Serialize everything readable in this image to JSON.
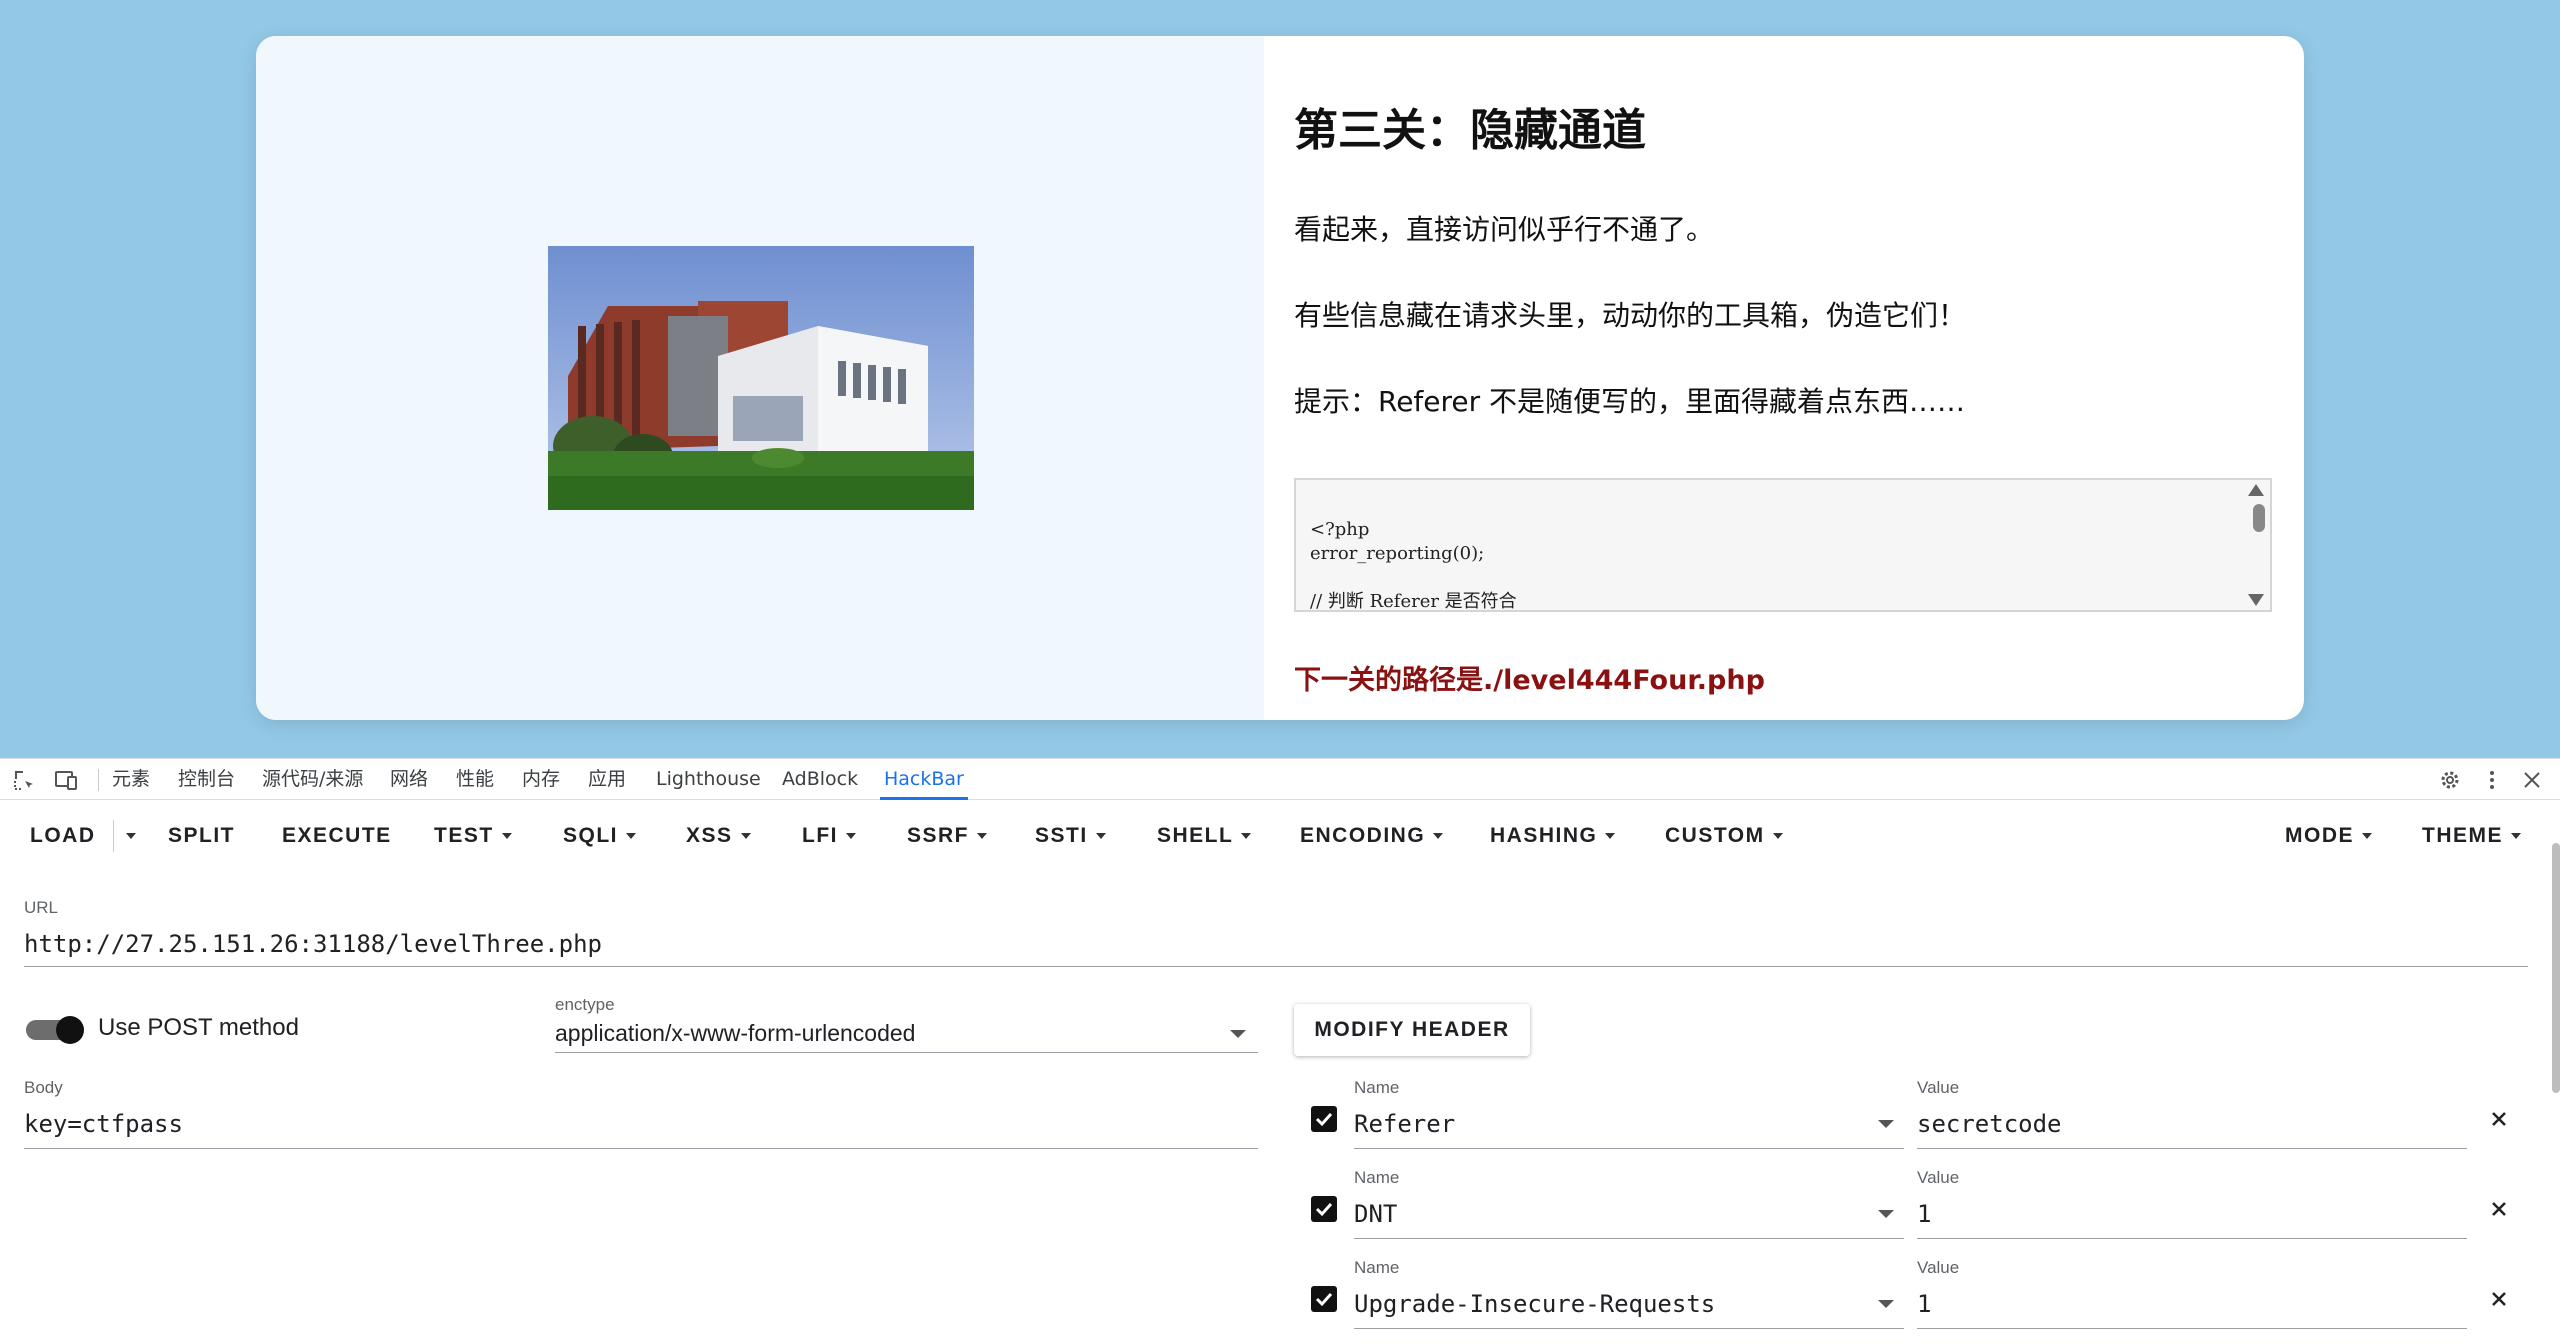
{
  "page": {
    "title": "第三关：隐藏通道",
    "paragraphs": [
      "看起来，直接访问似乎行不通了。",
      "有些信息藏在请求头里，动动你的工具箱，伪造它们！",
      "提示：Referer 不是随便写的，里面得藏着点东西……"
    ],
    "code_lines": "<?php\nerror_reporting(0);\n\n// 判断 Referer 是否符合",
    "next_path": "下一关的路径是./level444Four.php",
    "image_alt": "campus building photo"
  },
  "devtools": {
    "tabs": [
      "元素",
      "控制台",
      "源代码/来源",
      "网络",
      "性能",
      "内存",
      "应用",
      "Lighthouse",
      "AdBlock",
      "HackBar"
    ],
    "active_tab": "HackBar"
  },
  "hackbar": {
    "menu": {
      "load": "LOAD",
      "split": "SPLIT",
      "execute": "EXECUTE",
      "test": "TEST",
      "sqli": "SQLI",
      "xss": "XSS",
      "lfi": "LFI",
      "ssrf": "SSRF",
      "ssti": "SSTI",
      "shell": "SHELL",
      "encoding": "ENCODING",
      "hashing": "HASHING",
      "custom": "CUSTOM",
      "mode": "MODE",
      "theme": "THEME"
    },
    "url_label": "URL",
    "url_value": "http://27.25.151.26:31188/levelThree.php",
    "post_toggle_label": "Use POST method",
    "post_enabled": true,
    "enctype_label": "enctype",
    "enctype_value": "application/x-www-form-urlencoded",
    "body_label": "Body",
    "body_value": "key=ctfpass",
    "modify_header_label": "MODIFY HEADER",
    "name_label": "Name",
    "value_label": "Value",
    "headers": [
      {
        "name": "Referer",
        "value": "secretcode",
        "checked": true
      },
      {
        "name": "DNT",
        "value": "1",
        "checked": true
      },
      {
        "name": "Upgrade-Insecure-Requests",
        "value": "1",
        "checked": true
      }
    ]
  },
  "colors": {
    "background": "#93c9e6",
    "next_path": "#8a1111",
    "active_tab": "#1a73e8"
  }
}
